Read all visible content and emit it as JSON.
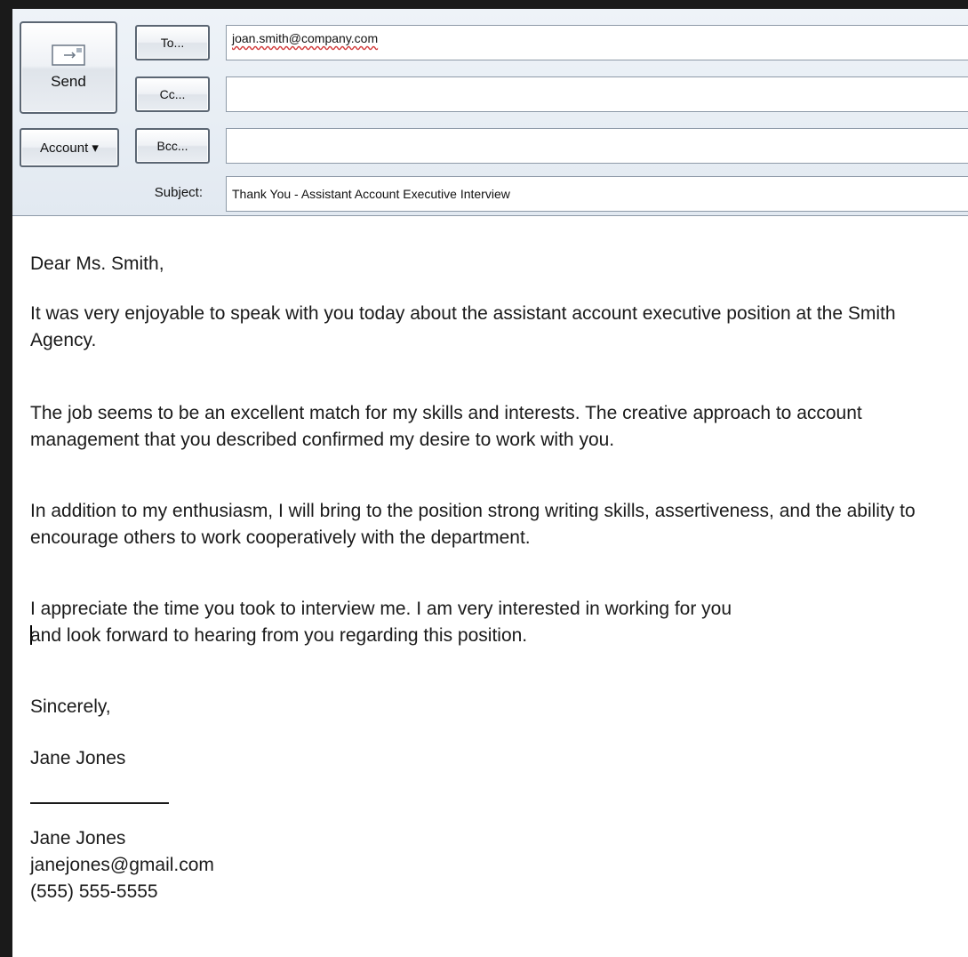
{
  "toolbar": {
    "send_label": "Send",
    "account_label": "Account ▾",
    "to_label": "To...",
    "cc_label": "Cc...",
    "bcc_label": "Bcc...",
    "subject_label": "Subject:"
  },
  "fields": {
    "to_value": "joan.smith@company.com",
    "cc_value": "",
    "bcc_value": "",
    "subject_value": "Thank You - Assistant Account Executive Interview"
  },
  "message": {
    "greeting": "Dear Ms. Smith,",
    "paragraph_1": "It was very enjoyable to speak with you today about the assistant account executive position at the Smith Agency.",
    "paragraph_2": "The job seems to be an excellent match for my skills and interests. The creative approach to account management that you described confirmed my desire to work with you.",
    "paragraph_3": "In addition to my enthusiasm, I will bring to the position strong writing skills, assertiveness, and the ability to encourage others to work cooperatively with the department.",
    "paragraph_4_line_1": "I appreciate the time you took to interview me. I am very interested in working for you",
    "paragraph_4_line_2": "and look forward to hearing from you regarding this position.",
    "closing": "Sincerely,",
    "signature_name": "Jane Jones",
    "contact_name": "Jane Jones",
    "contact_email": "janejones@gmail.com",
    "contact_phone": "(555) 555-5555"
  },
  "icons": {
    "send": "envelope-icon"
  }
}
